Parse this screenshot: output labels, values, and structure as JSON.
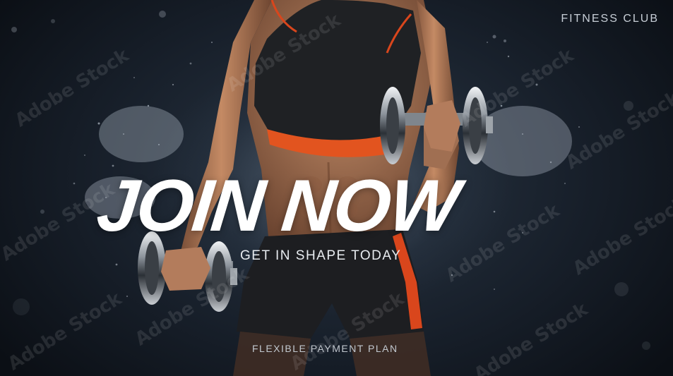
{
  "brand": {
    "label": "FITNESS CLUB"
  },
  "hero": {
    "headline": "JOIN NOW",
    "subtitle": "GET IN SHAPE TODAY"
  },
  "footer": {
    "text": "FLEXIBLE PAYMENT PLAN"
  },
  "watermark": {
    "text": "Adobe Stock"
  },
  "colors": {
    "background_dark": "#0d1218",
    "background_light": "#2a3644",
    "accent_orange": "#e2541f",
    "top_black": "#1e1f22",
    "skin": "#b9815e",
    "text_white": "#ffffff"
  }
}
